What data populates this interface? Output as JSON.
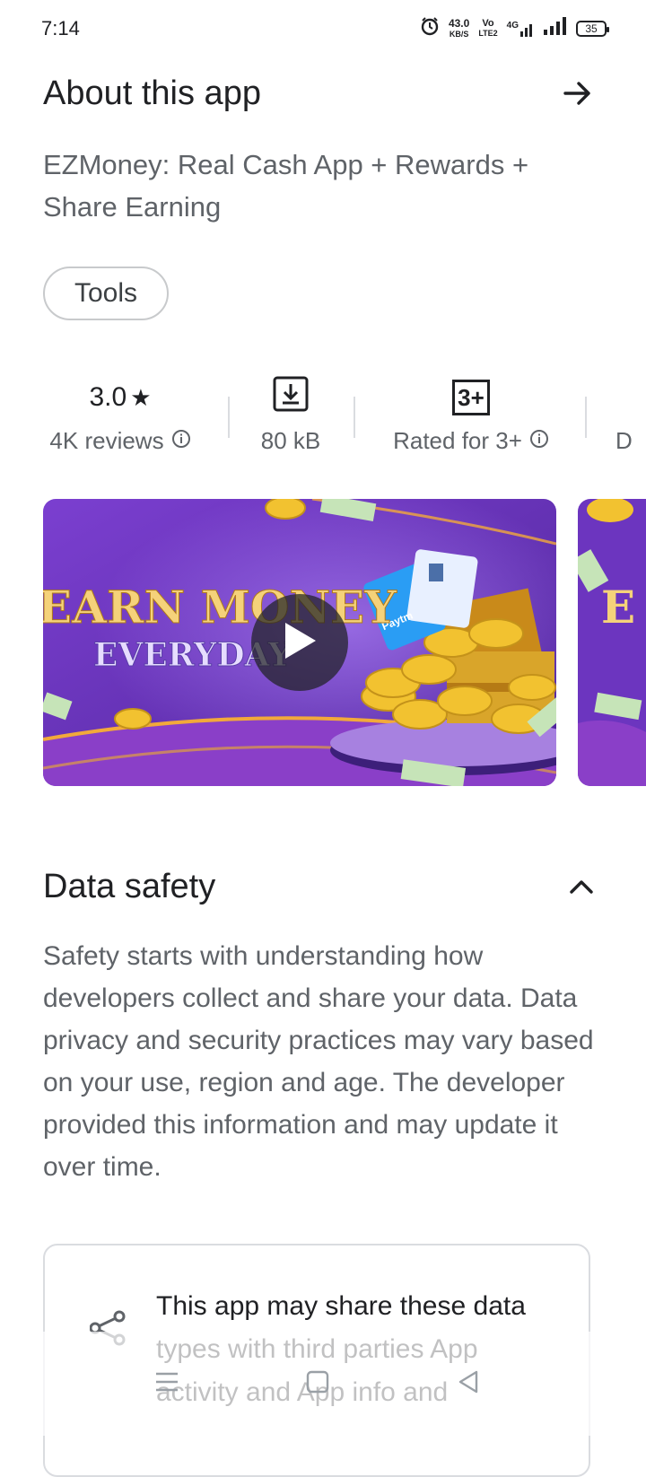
{
  "status": {
    "time": "7:14",
    "speed_value": "43.0",
    "speed_unit": "KB/S",
    "volte_top": "Vo",
    "volte_bottom": "LTE2",
    "net_type": "4G",
    "battery": "35"
  },
  "about": {
    "title": "About this app",
    "description": "EZMoney: Real Cash App + Rewards + Share Earning",
    "category_chip": "Tools"
  },
  "stats": {
    "rating_value": "3.0",
    "rating_star": "★",
    "reviews": "4K reviews",
    "size": "80 kB",
    "content_rating_badge": "3+",
    "content_rating": "Rated for 3+",
    "next_partial": "D"
  },
  "media": {
    "headline": "EARN MONEY",
    "subline": "EVERYDAY",
    "wallet_label": "Paytm",
    "next_card_partial": "E"
  },
  "data_safety": {
    "title": "Data safety",
    "body": "Safety starts with understanding how developers collect and share your data. Data privacy and security practices may vary based on your use, region and age. The developer provided this information and may update it over time.",
    "share_text": "This app may share these data types with third parties App activity and App info and"
  },
  "colors": {
    "text_primary": "#202124",
    "text_secondary": "#5f6368",
    "banner_purple": "#6b2fb8",
    "gold": "#f2c230"
  }
}
